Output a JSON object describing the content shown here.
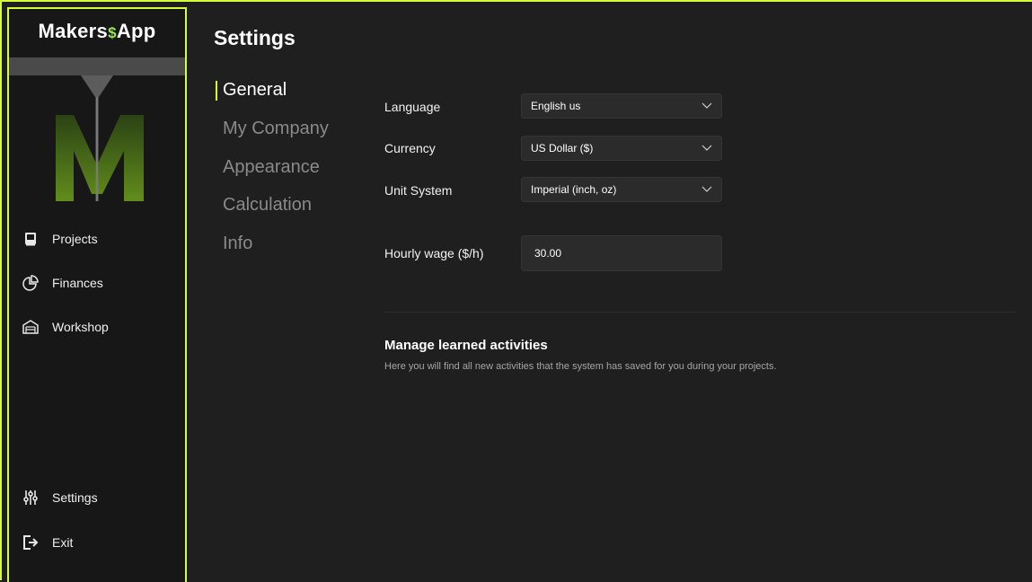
{
  "app": {
    "name_part1": "Makers",
    "name_dollar": "$",
    "name_part2": "App",
    "accent": "#d4ff3a"
  },
  "sidebar": {
    "items": [
      {
        "label": "Projects",
        "icon": "book-icon"
      },
      {
        "label": "Finances",
        "icon": "pie-chart-icon"
      },
      {
        "label": "Workshop",
        "icon": "garage-icon"
      }
    ],
    "bottom_items": [
      {
        "label": "Settings",
        "icon": "sliders-icon"
      },
      {
        "label": "Exit",
        "icon": "exit-icon"
      }
    ]
  },
  "main": {
    "title": "Settings",
    "subnav": [
      {
        "label": "General",
        "active": true
      },
      {
        "label": "My Company"
      },
      {
        "label": "Appearance"
      },
      {
        "label": "Calculation"
      },
      {
        "label": "Info"
      }
    ],
    "fields": {
      "language": {
        "label": "Language",
        "value": "English us"
      },
      "currency": {
        "label": "Currency",
        "value": "US Dollar ($)"
      },
      "unit_system": {
        "label": "Unit System",
        "value": "Imperial (inch, oz)"
      },
      "hourly_wage": {
        "label": "Hourly wage ($/h)",
        "value": "30.00"
      }
    },
    "learned": {
      "title": "Manage learned activities",
      "description": "Here you will find all new activities that the system has saved for you during your projects."
    }
  }
}
